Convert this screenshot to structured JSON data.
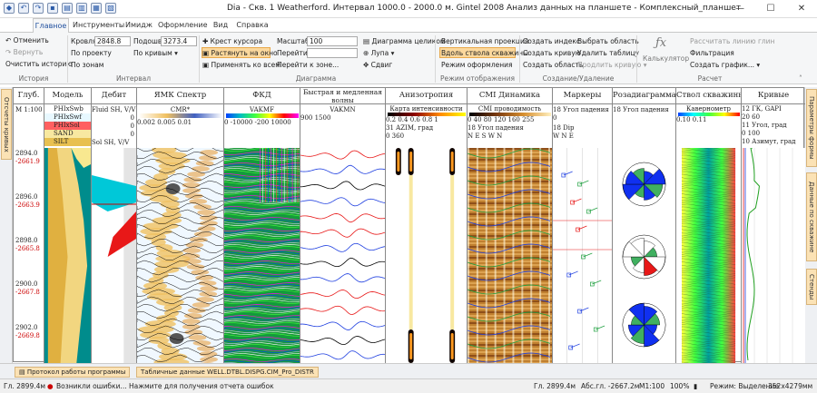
{
  "window": {
    "title": "Dia - Скв. 1 Weatherford. Интервал 1000.0 - 2000.0 м. Gintel 2008 Анализ данных на планшете - Комплексный_планшет"
  },
  "tabs": [
    "Главное",
    "Инструменты",
    "Имидж",
    "Оформление",
    "Вид",
    "Справка"
  ],
  "ribbon": {
    "history": {
      "undo": "Отменить",
      "redo": "Вернуть",
      "clear": "Очистить историю",
      "label": "История"
    },
    "interval": {
      "roof_label": "Кровля",
      "roof_value": "2848.8",
      "sole_label": "Подошва",
      "sole_value": "3273.4",
      "by_project": "По проекту",
      "by_curves": "По кривым",
      "by_zones": "По зонам",
      "label": "Интервал"
    },
    "diagram": {
      "cross": "Крест курсора",
      "stretch": "Растянуть на окно",
      "apply_all": "Применять ко всем",
      "scale_label": "Масштаб",
      "scale_value": "100",
      "goto": "Перейти",
      "goto_zone": "Перейти к зоне...",
      "whole": "Диаграмма целиком",
      "lens": "Лупа",
      "shift": "Сдвиг",
      "label": "Диаграмма"
    },
    "display": {
      "vertical": "Вертикальная проекция",
      "along": "Вдоль ствола скважины",
      "design": "Режим оформления",
      "label": "Режим отображения"
    },
    "create": {
      "index": "Создать индекс",
      "select_area": "Выбрать область",
      "curve": "Создать кривую",
      "del_table": "Удалить таблицу",
      "area": "Создать область",
      "extend": "Продлить кривую",
      "label": "Создание/Удаление"
    },
    "calc": {
      "calculator": "Калькулятор",
      "calc_line": "Рассчитать линию глин",
      "filter": "Фильтрация",
      "graph": "Создать график...",
      "label": "Расчет"
    }
  },
  "side_tabs": {
    "left": "Отсчеты кривых",
    "right": [
      "Параметры формы",
      "Данные по скважине",
      "Стенды"
    ]
  },
  "tracks": [
    {
      "header": "Глуб.",
      "sub": [
        "М 1:100"
      ]
    },
    {
      "header": "Модель",
      "sub": [
        "PHIxSwb",
        "PHIxSwf",
        "PHIxSol",
        "SAND",
        "SILT"
      ]
    },
    {
      "header": "Дебит",
      "sub": [
        "Fluid SH, V/V",
        "0",
        "0",
        "0",
        "Sol SH, V/V"
      ]
    },
    {
      "header": "ЯМК Спектр",
      "sub": [
        "CMR*",
        "0.002   0.005     0.01"
      ]
    },
    {
      "header": "ФКД",
      "sub": [
        "VAKMF",
        "0   -10000  -200   10000"
      ]
    },
    {
      "header": "Быстрая и медленная волны",
      "sub": [
        "VAKMN",
        "900                1500"
      ]
    },
    {
      "header": "Анизотропия",
      "sub": [
        "Карта интенсивности",
        "0.2  0.4  0.6  0.8  1",
        "31  AZIM, град",
        "0             360"
      ]
    },
    {
      "header": "СМI Динамика",
      "sub": [
        "СМI проводимость",
        "0  40  80  120 160  255",
        "18  Угол падения",
        "N  E  S  W  N"
      ]
    },
    {
      "header": "Маркеры",
      "sub": [
        "18  Угол падения",
        "0",
        "18  Dip",
        "W   N   E"
      ]
    },
    {
      "header": "Розадиаграмма",
      "sub": [
        "18  Угол падения"
      ]
    },
    {
      "header": "Ствол скважины",
      "sub": [
        "Кавернометр",
        "0.10      0.11"
      ]
    },
    {
      "header": "Кривые",
      "sub": [
        "12 ГК, GAPI",
        "20          60",
        "11 Угол, град",
        "0          100",
        "10 Азимут, град"
      ]
    }
  ],
  "depths": [
    {
      "md": "2894.0",
      "tvd": "-2661.9"
    },
    {
      "md": "2896.0",
      "tvd": "-2663.9"
    },
    {
      "md": "2898.0",
      "tvd": "-2665.8"
    },
    {
      "md": "2900.0",
      "tvd": "-2667.8"
    },
    {
      "md": "2902.0",
      "tvd": "-2669.8"
    }
  ],
  "bottom_tabs": [
    "Протокол работы программы",
    "Табличные данные WELL.DTBL.DISPG.CIM_Pro_DISTR"
  ],
  "status": {
    "depth": "Гл. 2899.4м",
    "error": "Возникли ошибки... Нажмите для получения отчета ошибок",
    "depth2": "Гл. 2899.4м",
    "abs": "Абс.гл. -2667.2м",
    "scale": "М1:100",
    "zoom": "100%",
    "mode": "Режим: Выделение",
    "size": "352x4279мм"
  },
  "colors": {
    "accent": "#1e4e9e",
    "highlight": "#fbd89d",
    "red": "#cc0000"
  }
}
